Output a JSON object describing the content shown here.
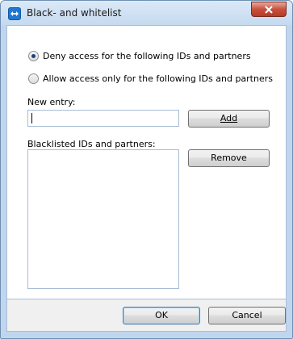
{
  "window": {
    "title": "Black- and whitelist"
  },
  "options": {
    "deny_label": "Deny access for the following IDs and partners",
    "allow_label": "Allow access only for the following IDs and partners",
    "selected": "deny"
  },
  "new_entry": {
    "label": "New entry:",
    "value": "",
    "add_label": "Add"
  },
  "blacklist": {
    "label": "Blacklisted IDs and partners:",
    "items": [],
    "remove_label": "Remove"
  },
  "footer": {
    "ok_label": "OK",
    "cancel_label": "Cancel"
  },
  "colors": {
    "accent": "#1e78d0",
    "close": "#c7503d"
  }
}
